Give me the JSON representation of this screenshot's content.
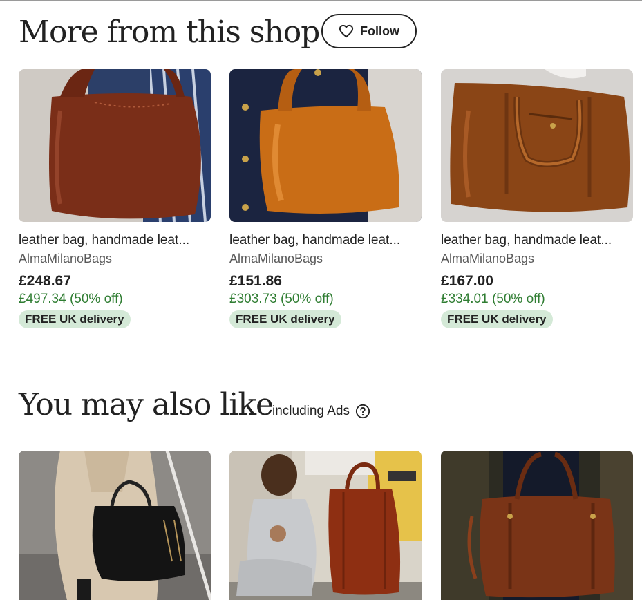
{
  "shop_section": {
    "title": "More from this shop",
    "follow_label": "Follow",
    "items": [
      {
        "title": "leather bag, handmade leat...",
        "shop": "AlmaMilanoBags",
        "price": "£248.67",
        "original_price": "£497.34",
        "discount": "(50% off)",
        "badge": "FREE UK delivery"
      },
      {
        "title": "leather bag, handmade leat...",
        "shop": "AlmaMilanoBags",
        "price": "£151.86",
        "original_price": "£303.73",
        "discount": "(50% off)",
        "badge": "FREE UK delivery"
      },
      {
        "title": "leather bag, handmade leat...",
        "shop": "AlmaMilanoBags",
        "price": "£167.00",
        "original_price": "£334.01",
        "discount": "(50% off)",
        "badge": "FREE UK delivery"
      }
    ]
  },
  "also_section": {
    "title": "You may also like",
    "ads_note": "including Ads"
  },
  "colors": {
    "discount_green": "#2f7d32",
    "badge_bg": "#d4e9d7",
    "text": "#222222"
  },
  "icons": [
    "heart-icon",
    "help-icon"
  ]
}
